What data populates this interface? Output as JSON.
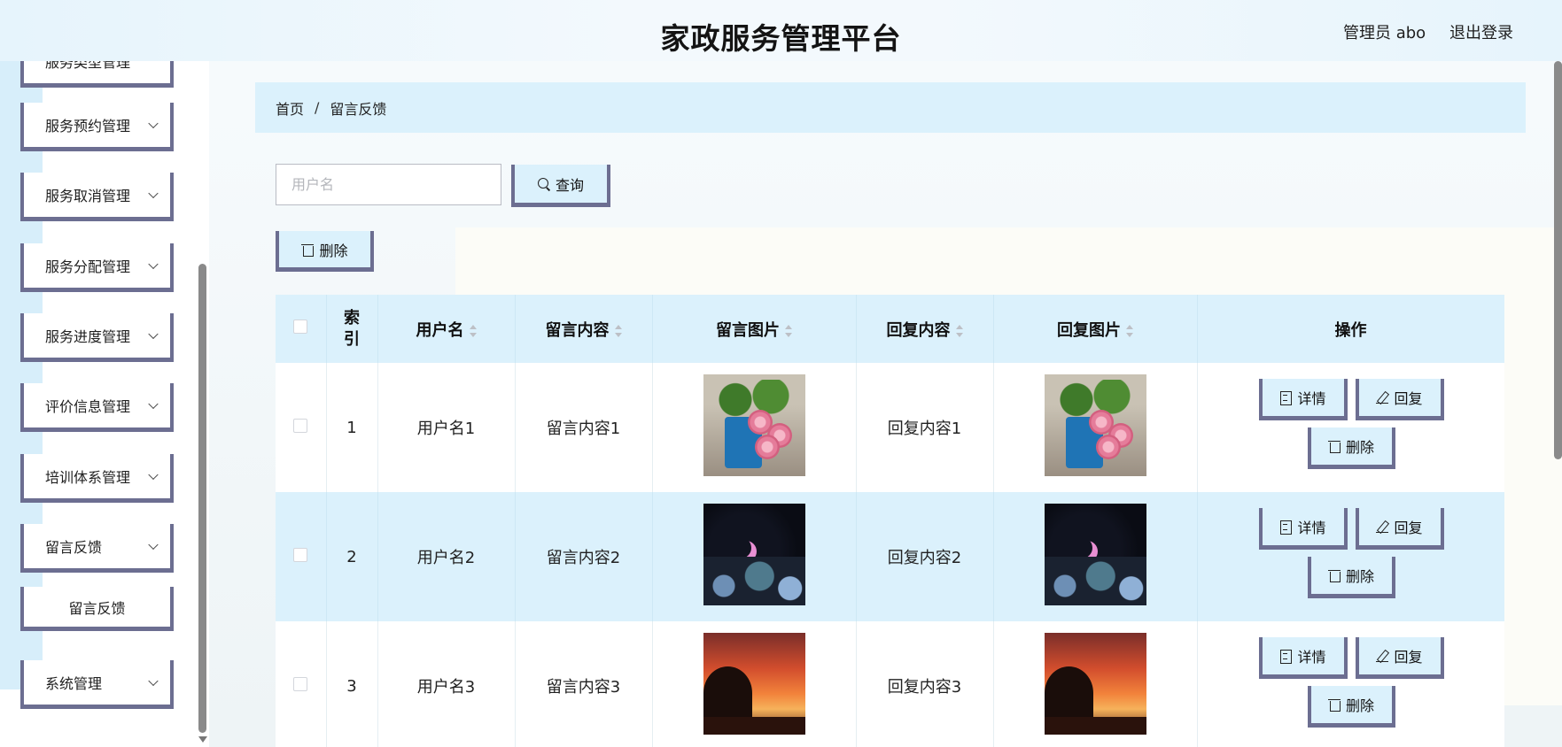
{
  "header": {
    "title": "家政服务管理平台",
    "user": "管理员 abo",
    "logout": "退出登录"
  },
  "sidebar": {
    "items": [
      {
        "label": "服务类型管理"
      },
      {
        "label": "服务预约管理"
      },
      {
        "label": "服务取消管理"
      },
      {
        "label": "服务分配管理"
      },
      {
        "label": "服务进度管理"
      },
      {
        "label": "评价信息管理"
      },
      {
        "label": "培训体系管理"
      },
      {
        "label": "留言反馈"
      },
      {
        "label": "系统管理"
      }
    ],
    "submenu": {
      "label": "留言反馈"
    }
  },
  "breadcrumb": {
    "home": "首页",
    "separator": "/",
    "current": "留言反馈"
  },
  "search": {
    "placeholder": "用户名",
    "value": "",
    "button": "查询"
  },
  "toolbar": {
    "delete": "删除"
  },
  "table": {
    "headers": {
      "index": "索引",
      "username": "用户名",
      "content": "留言内容",
      "image": "留言图片",
      "reply": "回复内容",
      "reply_image": "回复图片",
      "actions": "操作"
    },
    "rows": [
      {
        "index": "1",
        "username": "用户名1",
        "content": "留言内容1",
        "image": "flowers-watering-can",
        "reply": "回复内容1",
        "reply_image": "flowers-watering-can"
      },
      {
        "index": "2",
        "username": "用户名2",
        "content": "留言内容2",
        "image": "night-moon-foliage",
        "reply": "回复内容2",
        "reply_image": "night-moon-foliage"
      },
      {
        "index": "3",
        "username": "用户名3",
        "content": "留言内容3",
        "image": "sunset-tree",
        "reply": "回复内容3",
        "reply_image": "sunset-tree"
      }
    ],
    "actions": {
      "detail": "详情",
      "reply": "回复",
      "delete": "删除"
    }
  },
  "colors": {
    "accent_light": "#dbf1fc",
    "button_border": "#6c6e91",
    "header_bg": "#e6f4fc"
  }
}
